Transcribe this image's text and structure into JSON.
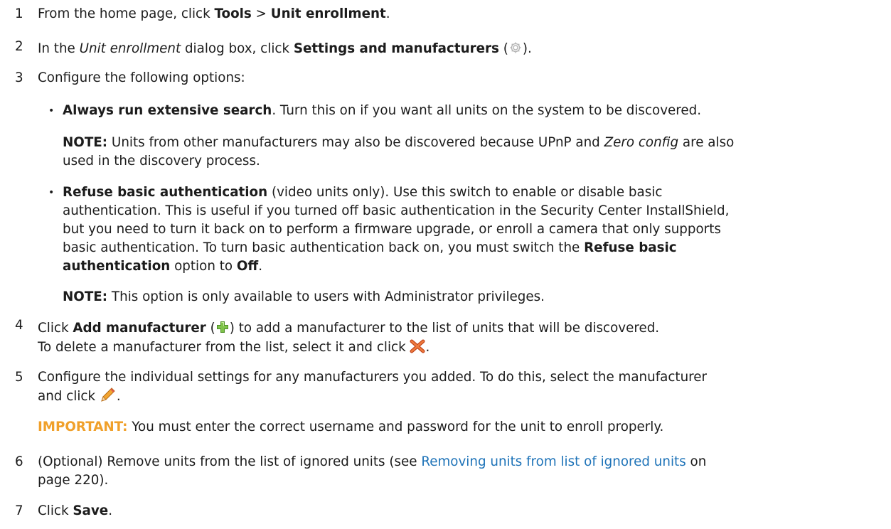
{
  "steps": [
    {
      "number": "1",
      "text_a": "From the home page, click ",
      "bold_a": "Tools",
      "text_b": " > ",
      "bold_b": "Unit enrollment",
      "text_c": "."
    },
    {
      "number": "2",
      "text_a": "In the ",
      "italic_a": "Unit enrollment",
      "text_b": " dialog box, click ",
      "bold_a": "Settings and manufacturers",
      "text_c": " (",
      "icon": "gear-icon",
      "text_d": ")."
    },
    {
      "number": "3",
      "text_a": "Configure the following options:"
    },
    {
      "number": "4",
      "text_a": "Click ",
      "bold_a": "Add manufacturer",
      "text_b": " (",
      "icon": "green-plus-icon",
      "text_c": ") to add a manufacturer to the list of units that will be discovered.",
      "sub_a": "To delete a manufacturer from the list, select it and click ",
      "sub_icon": "red-x-icon",
      "sub_b": "."
    },
    {
      "number": "5",
      "line1": "Configure the individual settings for any manufacturers you added. To do this, select the manufacturer",
      "line2_a": "and click ",
      "icon": "pencil-icon",
      "line2_b": ".",
      "important_label": "IMPORTANT:",
      "important_text": "  You must enter the correct username and password for the unit to enroll properly."
    },
    {
      "number": "6",
      "line1_a": "(Optional) Remove units from the list of ignored units (see ",
      "link": "Removing units from list of ignored units",
      "line1_b": " on",
      "line2": "page 220)."
    },
    {
      "number": "7",
      "text_a": "Click ",
      "bold_a": "Save",
      "text_b": "."
    }
  ],
  "options": [
    {
      "bullet": "•",
      "bold": "Always run extensive search",
      "text": ". Turn this on if you want all units on the system to be discovered.",
      "note_label": "NOTE:",
      "note_a": "  Units from other manufacturers may also be discovered because UPnP and ",
      "note_italic": "Zero config",
      "note_b": " are also",
      "note_line2": "used in the discovery process."
    },
    {
      "bullet": "•",
      "bold": "Refuse basic authentication",
      "line1": " (video units only). Use this switch to enable or disable basic",
      "line2": "authentication. This is useful if you turned off basic authentication in the Security Center InstallShield,",
      "line3": "but you need to turn it back on to perform a firmware upgrade, or enroll a camera that only supports",
      "line4_a": "basic authentication. To turn basic authentication back on, you must switch the ",
      "line4_bold": "Refuse basic",
      "line5_bold_a": "authentication",
      "line5_a": " option to ",
      "line5_bold_b": "Off",
      "line5_b": ".",
      "note_label": "NOTE:",
      "note_text": "  This option is only available to users with Administrator privileges."
    }
  ],
  "colors": {
    "link": "#1e73b8",
    "important": "#f0a02a",
    "text": "#1c1c1c"
  }
}
